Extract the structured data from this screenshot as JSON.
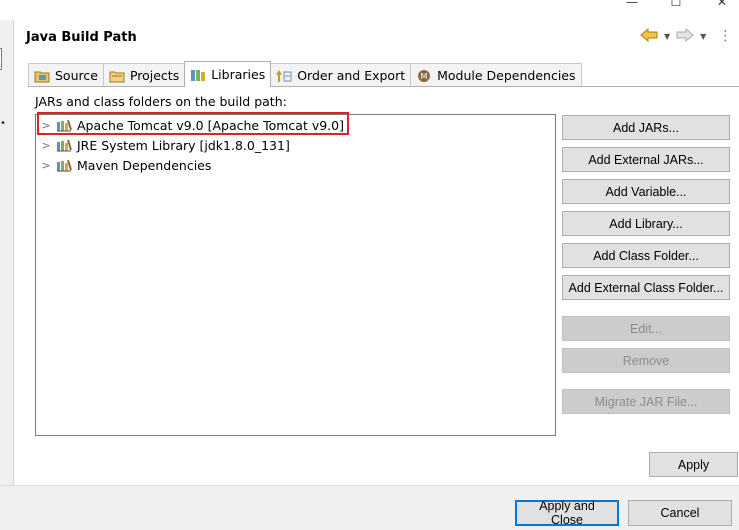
{
  "window": {
    "minimize_glyph": "—",
    "maximize_glyph": "☐",
    "close_glyph": "✕"
  },
  "header": {
    "title": "Java Build Path",
    "nav_icons": [
      "back-arrow-icon",
      "forward-arrow-icon",
      "menu-more-icon"
    ]
  },
  "tabs": [
    {
      "label": "Source",
      "icon": "source-folder-icon",
      "active": false
    },
    {
      "label": "Projects",
      "icon": "projects-folder-icon",
      "active": false
    },
    {
      "label": "Libraries",
      "icon": "libraries-icon",
      "active": true
    },
    {
      "label": "Order and Export",
      "icon": "order-export-icon",
      "active": false
    },
    {
      "label": "Module Dependencies",
      "icon": "module-icon",
      "active": false
    }
  ],
  "libraries": {
    "label": "JARs and class folders on the build path:",
    "items": [
      {
        "label": "Apache Tomcat v9.0 [Apache Tomcat v9.0]",
        "icon": "library-container-icon",
        "highlighted": true
      },
      {
        "label": "JRE System Library [jdk1.8.0_131]",
        "icon": "library-container-icon",
        "highlighted": false
      },
      {
        "label": "Maven Dependencies",
        "icon": "library-container-icon",
        "highlighted": false
      }
    ]
  },
  "buttons": {
    "add_jars": "Add JARs...",
    "add_external_jars": "Add External JARs...",
    "add_variable": "Add Variable...",
    "add_library": "Add Library...",
    "add_class_folder": "Add Class Folder...",
    "add_external_class_folder": "Add External Class Folder...",
    "edit": "Edit...",
    "remove": "Remove",
    "migrate_jar": "Migrate JAR File...",
    "apply": "Apply"
  },
  "footer": {
    "apply_and_close": "Apply and Close",
    "cancel": "Cancel"
  },
  "colors": {
    "highlight_border": "#e0202a",
    "default_button_border": "#0078d7"
  }
}
